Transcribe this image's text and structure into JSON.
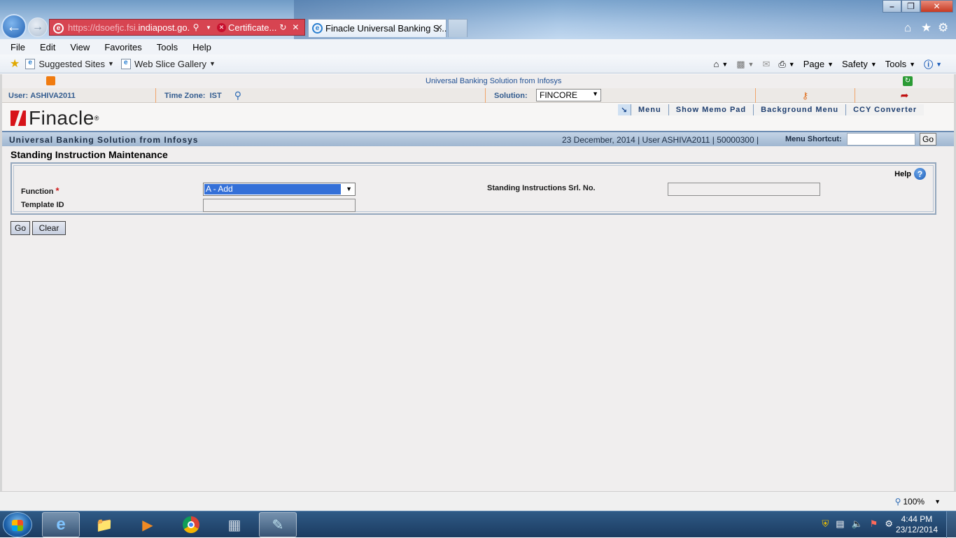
{
  "browser": {
    "address_url_dim": "https://",
    "address_url_blur": "dsoefjc.fsi.",
    "address_url_main": "indiapost.go...",
    "cert_label": "Certificate...",
    "active_tab": "Finacle Universal Banking S...",
    "menu": [
      "File",
      "Edit",
      "View",
      "Favorites",
      "Tools",
      "Help"
    ],
    "favorites": [
      "Suggested Sites",
      "Web Slice Gallery"
    ],
    "commands": [
      "Page",
      "Safety",
      "Tools"
    ],
    "zoom": "100%"
  },
  "app": {
    "header_center": "Universal Banking Solution from Infosys",
    "user_label": "User:",
    "user_value": "ASHIVA2011",
    "tz_label": "Time Zone:",
    "tz_value": "IST",
    "solution_label": "Solution:",
    "solution_value": "FINCORE",
    "logo_text": "Finacle",
    "top_menu": [
      "Menu",
      "Show Memo Pad",
      "Background Menu",
      "CCY Converter"
    ],
    "bar_title": "Universal Banking Solution from Infosys",
    "bar_info": "23 December, 2014  |  User  ASHIVA2011  |  50000300  |",
    "shortcut_label": "Menu Shortcut:",
    "shortcut_go": "Go"
  },
  "form": {
    "title": "Standing Instruction Maintenance",
    "help": "Help",
    "function_label": "Function",
    "required_mark": "*",
    "function_value": "A - Add",
    "template_label": "Template ID",
    "template_value": "",
    "srl_label": "Standing Instructions Srl. No.",
    "srl_value": "",
    "go_button": "Go",
    "clear_button": "Clear"
  },
  "taskbar": {
    "time": "4:44 PM",
    "date": "23/12/2014"
  },
  "colors": {
    "accent_blue": "#3470d8",
    "logo_red": "#d7141a",
    "bar_blue": "#9fb6d0"
  }
}
